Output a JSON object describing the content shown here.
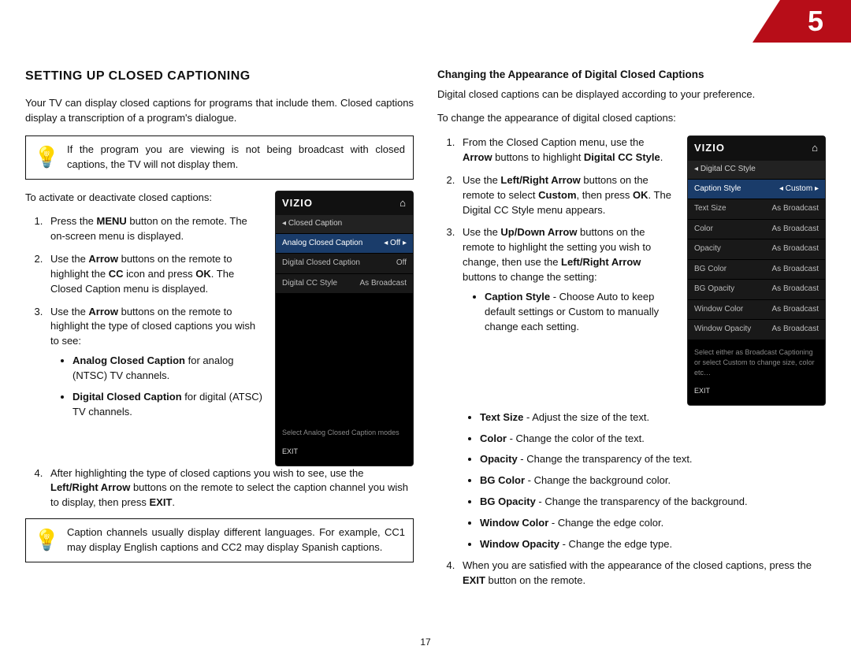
{
  "page": {
    "tab": "5",
    "number": "17"
  },
  "left": {
    "h1": "SETTING UP CLOSED CAPTIONING",
    "intro": "Your TV can display closed captions for programs that include them. Closed captions display a transcription of a program's dialogue.",
    "tip1": "If the program you are viewing is not being broadcast with closed captions, the TV will not display them.",
    "activate_label": "To activate or deactivate closed captions:",
    "steps": {
      "s1a": "Press the ",
      "s1b": "MENU",
      "s1c": " button on the remote. The on-screen menu is displayed.",
      "s2a": "Use the ",
      "s2b": "Arrow",
      "s2c": " buttons on the remote to highlight the ",
      "s2d": "CC",
      "s2e": " icon and press ",
      "s2f": "OK",
      "s2g": ". The Closed Caption menu is displayed.",
      "s3a": "Use the ",
      "s3b": "Arrow",
      "s3c": " buttons on the remote to highlight the type of closed captions you wish to see:",
      "b1a": "Analog Closed Caption",
      "b1b": " for analog (NTSC) TV channels.",
      "b2a": "Digital Closed Caption",
      "b2b": " for digital (ATSC) TV channels.",
      "s4a": "After highlighting the type of closed captions you wish to see, use the ",
      "s4b": "Left/Right Arrow",
      "s4c": " buttons on the remote to select the caption channel you wish to display, then press ",
      "s4d": "EXIT",
      "s4e": "."
    },
    "tip2": "Caption channels usually display different languages. For example, CC1 may display English captions and CC2 may display Spanish captions.",
    "shot": {
      "brand": "VIZIO",
      "home": "⌂",
      "back": "◂",
      "sub": "Closed Caption",
      "rows": [
        {
          "l": "Analog Closed Caption",
          "r": "◂ Off ▸",
          "sel": true
        },
        {
          "l": "Digital Closed Caption",
          "r": "Off",
          "sel": false
        },
        {
          "l": "Digital CC Style",
          "r": "As Broadcast",
          "sel": false
        }
      ],
      "footer": "Select Analog Closed Caption modes",
      "exit": "EXIT"
    }
  },
  "right": {
    "h2": "Changing the Appearance of Digital Closed Captions",
    "intro": "Digital closed captions can be displayed according to your preference.",
    "lead": "To change the appearance of digital closed captions:",
    "steps": {
      "s1a": "From the Closed Caption menu, use the ",
      "s1b": "Arrow",
      "s1c": " buttons to highlight ",
      "s1d": "Digital CC Style",
      "s1e": ".",
      "s2a": "Use the ",
      "s2b": "Left/Right Arrow",
      "s2c": " buttons on the remote to select ",
      "s2d": "Custom",
      "s2e": ", then press ",
      "s2f": "OK",
      "s2g": ". The Digital CC Style menu appears.",
      "s3a": "Use the ",
      "s3b": "Up/Down Arrow",
      "s3c": " buttons on the remote to highlight the setting you wish to change, then use the ",
      "s3d": "Left/Right Arrow",
      "s3e": " buttons to change the setting:"
    },
    "bullets": {
      "b1a": "Caption Style",
      "b1b": " - Choose Auto to keep default settings or Custom to manually change each setting.",
      "b2a": "Text Size",
      "b2b": " - Adjust the size of the text.",
      "b3a": "Color",
      "b3b": " - Change the color of the text.",
      "b4a": "Opacity",
      "b4b": " - Change the transparency of the text.",
      "b5a": "BG Color",
      "b5b": " - Change the background color.",
      "b6a": "BG Opacity",
      "b6b": " - Change the transparency of the background.",
      "b7a": "Window Color",
      "b7b": " - Change the edge color.",
      "b8a": "Window Opacity",
      "b8b": " - Change the edge type."
    },
    "s4a": "When you are satisfied with the appearance of the closed captions, press the ",
    "s4b": "EXIT",
    "s4c": " button on the remote.",
    "shot": {
      "brand": "VIZIO",
      "home": "⌂",
      "back": "◂",
      "sub": "Digital CC Style",
      "rows": [
        {
          "l": "Caption Style",
          "r": "◂ Custom ▸",
          "sel": true
        },
        {
          "l": "Text Size",
          "r": "As Broadcast",
          "sel": false
        },
        {
          "l": "Color",
          "r": "As Broadcast",
          "sel": false
        },
        {
          "l": "Opacity",
          "r": "As Broadcast",
          "sel": false
        },
        {
          "l": "BG Color",
          "r": "As Broadcast",
          "sel": false
        },
        {
          "l": "BG Opacity",
          "r": "As Broadcast",
          "sel": false
        },
        {
          "l": "Window Color",
          "r": "As Broadcast",
          "sel": false
        },
        {
          "l": "Window Opacity",
          "r": "As Broadcast",
          "sel": false
        }
      ],
      "footer": "Select either as Broadcast Captioning or select Custom to change size, color etc…",
      "exit": "EXIT"
    }
  }
}
